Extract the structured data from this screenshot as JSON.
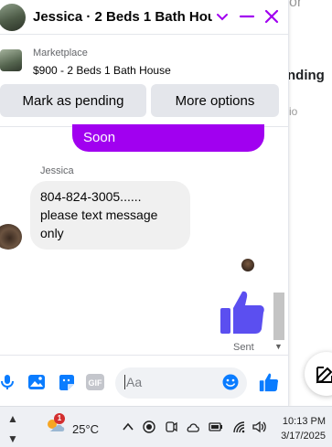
{
  "background": {
    "partial_top": "or",
    "partial_heading": "nding",
    "partial_sub": "io"
  },
  "header": {
    "title": "Jessica · 2 Beds 1 Bath Hou...",
    "accent": "#a100f0"
  },
  "marketplace": {
    "label": "Marketplace",
    "listing": "$900 - 2 Beds 1 Bath House"
  },
  "actions": {
    "pending": "Mark as pending",
    "more": "More options"
  },
  "messages": {
    "sent_fragment": "Soon",
    "sender_name": "Jessica",
    "received_line1": "804-824-3005......",
    "received_line2": "please text message",
    "received_line3": "only",
    "sent_status": "Sent"
  },
  "composer": {
    "placeholder": "Aa",
    "gif_label": "GIF"
  },
  "taskbar": {
    "weather_badge": "1",
    "temperature": "25°C",
    "time": "10:13 PM",
    "date": "3/17/2025"
  },
  "colors": {
    "messenger_blue": "#0a7cff",
    "sent_bubble": "#a100f0",
    "like_thumb": "#5b4ff0"
  }
}
